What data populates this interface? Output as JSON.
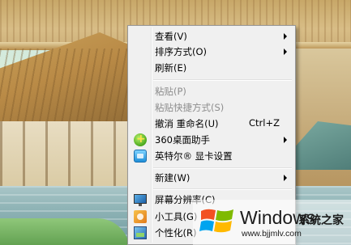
{
  "menu": {
    "items": [
      {
        "label": "查看(V)",
        "submenu": true
      },
      {
        "label": "排序方式(O)",
        "submenu": true
      },
      {
        "label": "刷新(E)"
      },
      {
        "label": "粘贴(P)",
        "disabled": true
      },
      {
        "label": "粘贴快捷方式(S)",
        "disabled": true
      },
      {
        "label": "撤消 重命名(U)",
        "shortcut": "Ctrl+Z"
      },
      {
        "label": "360桌面助手",
        "icon": "360-icon",
        "submenu": true
      },
      {
        "label": "英特尔® 显卡设置",
        "icon": "intel-graphics-icon"
      },
      {
        "label": "新建(W)",
        "submenu": true
      },
      {
        "label": "屏幕分辨率(C)",
        "icon": "monitor-icon"
      },
      {
        "label": "小工具(G)",
        "icon": "gadgets-icon"
      },
      {
        "label": "个性化(R)",
        "icon": "personalize-icon"
      }
    ]
  },
  "watermark": {
    "brand": "Windows",
    "subtitle": "系统之家",
    "url": "www.bjjmlv.com"
  }
}
